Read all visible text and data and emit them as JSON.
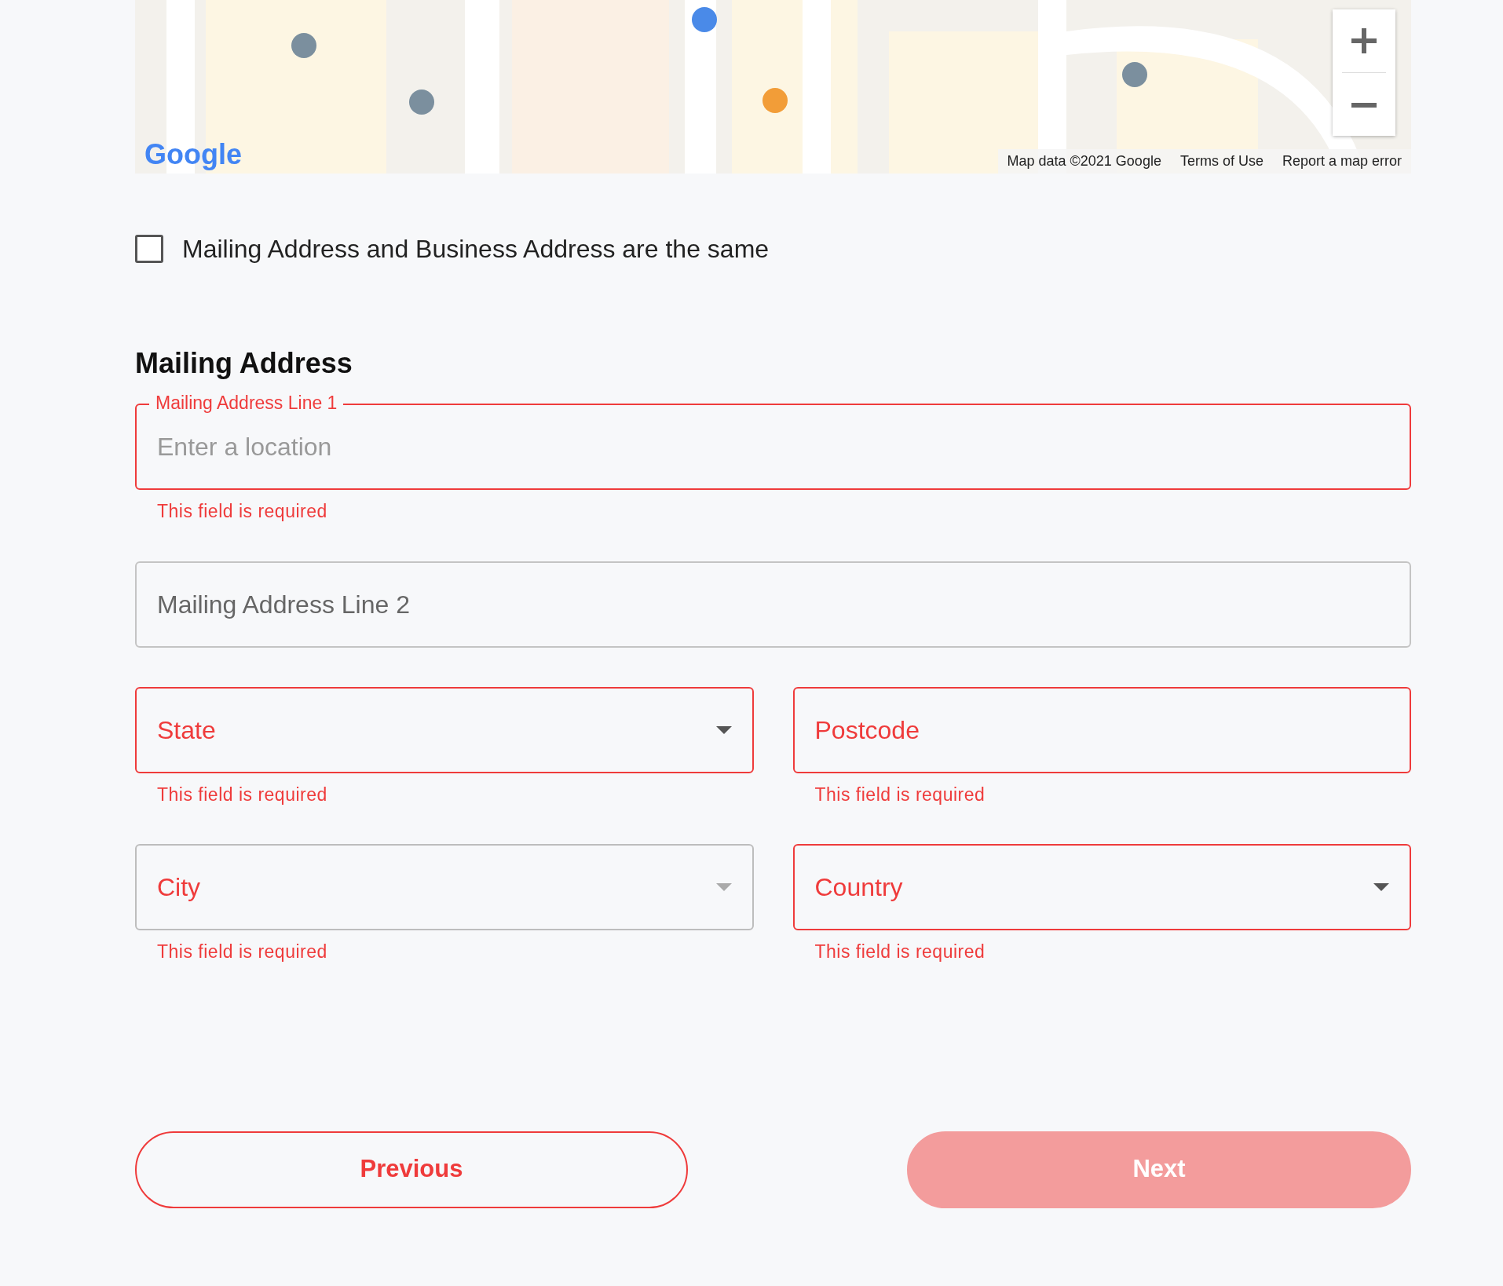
{
  "map": {
    "kind": "picture",
    "logo": "Google",
    "attribution": [
      "Map data ©2021 Google",
      "Terms of Use",
      "Report a map error"
    ]
  },
  "same_address": {
    "label": "Mailing Address and Business Address are the same",
    "checked": false
  },
  "section_title": "Mailing Address",
  "rows": [
    [
      {
        "kind": "text",
        "label": "Mailing Address Line 1",
        "placeholder": "Enter a location",
        "floating": true,
        "error": true,
        "disabled": false,
        "message": "This field is required"
      }
    ],
    [
      {
        "kind": "text",
        "label": "Mailing Address Line 2",
        "floating": false,
        "error": false,
        "disabled": false
      }
    ],
    [
      {
        "kind": "select",
        "label": "State",
        "floating": false,
        "error": true,
        "disabled": false,
        "message": "This field is required"
      },
      {
        "kind": "text",
        "label": "Postcode",
        "floating": false,
        "error": true,
        "disabled": false,
        "message": "This field is required"
      }
    ],
    [
      {
        "kind": "select",
        "label": "City",
        "floating": false,
        "error": true,
        "disabled": true,
        "message": "This field is required"
      },
      {
        "kind": "select",
        "label": "Country",
        "floating": false,
        "error": true,
        "disabled": false,
        "message": "This field is required"
      }
    ]
  ],
  "buttons": [
    {
      "label": "Previous",
      "kind": "outline",
      "disabled": false
    },
    {
      "label": "Next",
      "kind": "primary",
      "disabled": true
    }
  ]
}
